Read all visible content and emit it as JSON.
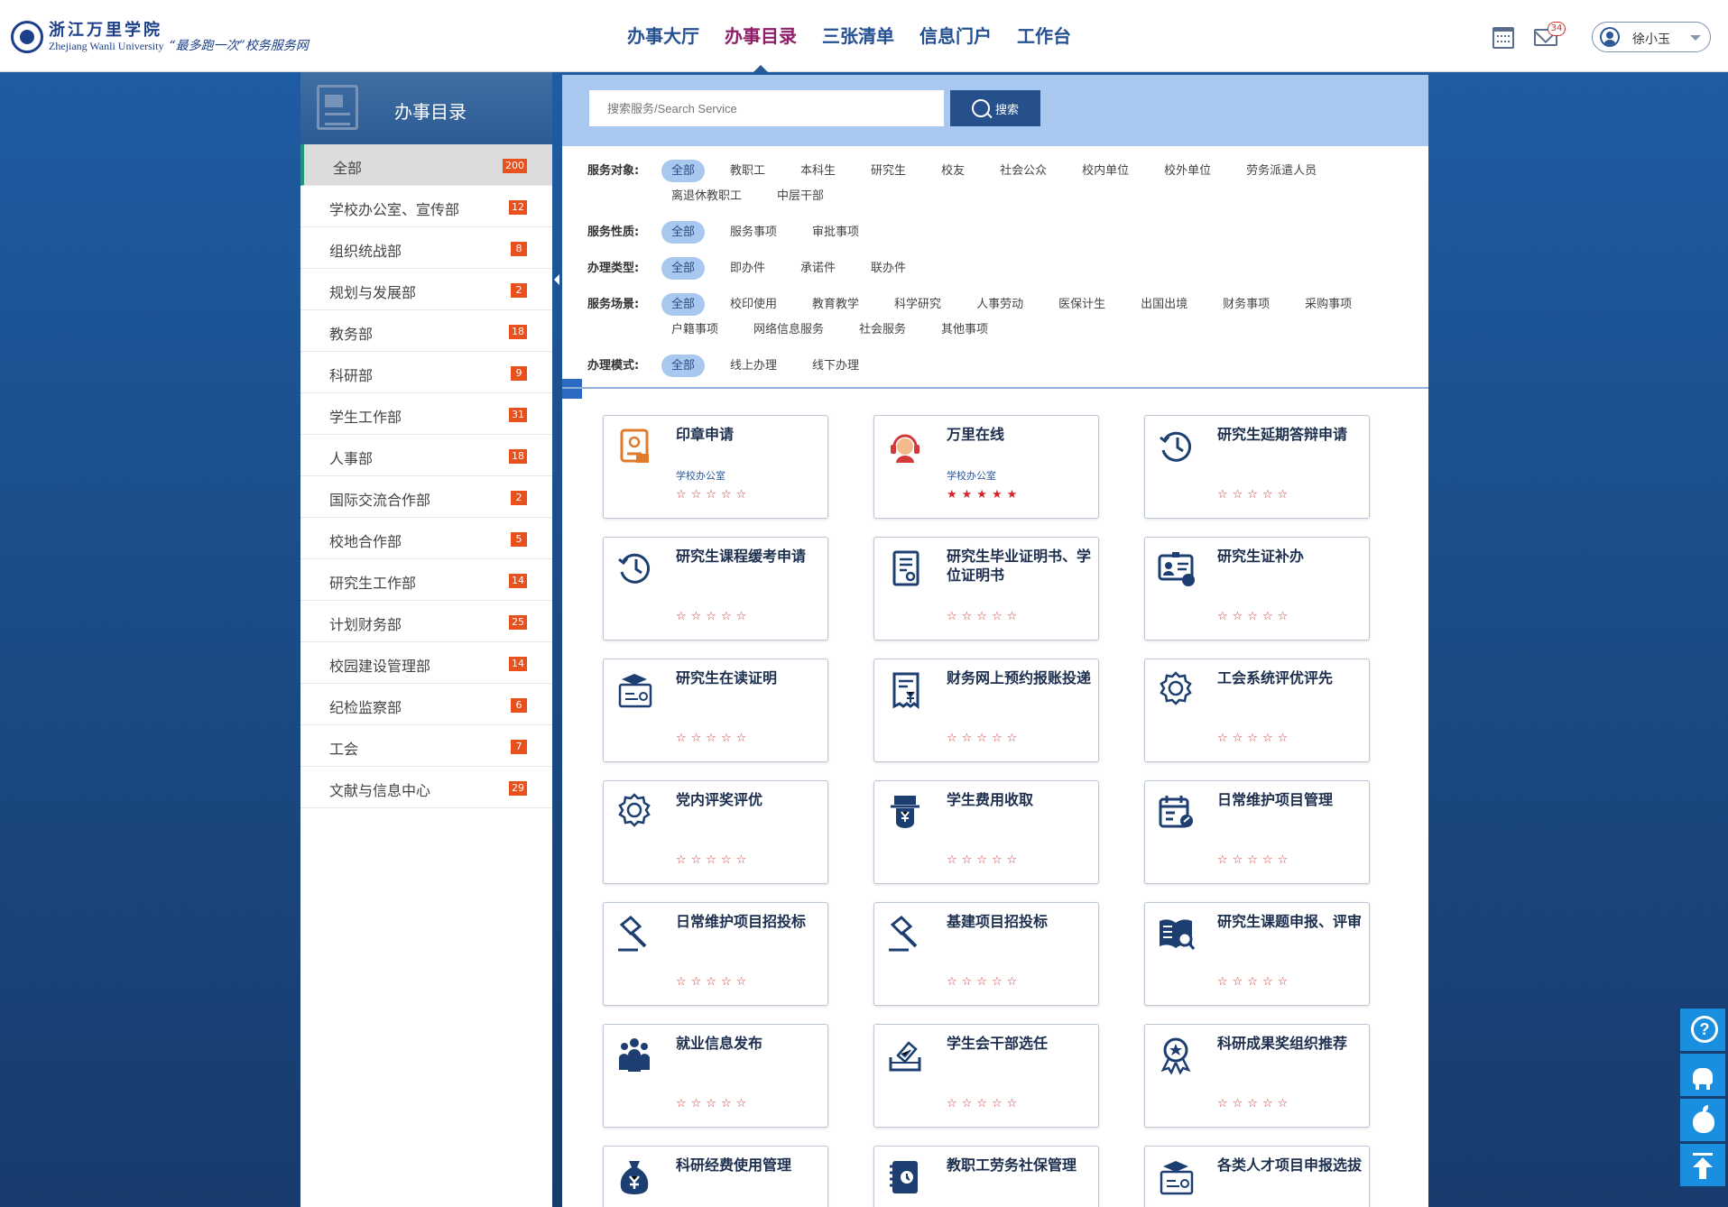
{
  "header": {
    "logo_cn": "浙江万里学院",
    "logo_en": "Zhejiang Wanli University",
    "slogan": "“最多跑一次”校务服务网",
    "nav": [
      {
        "label": "办事大厅",
        "active": false
      },
      {
        "label": "办事目录",
        "active": true
      },
      {
        "label": "三张清单",
        "active": false
      },
      {
        "label": "信息门户",
        "active": false
      },
      {
        "label": "工作台",
        "active": false
      }
    ],
    "mail_count": "34",
    "user_name": "徐小玉"
  },
  "sidebar": {
    "title": "办事目录",
    "items": [
      {
        "label": "全部",
        "count": "200",
        "active": true
      },
      {
        "label": "学校办公室、宣传部",
        "count": "12"
      },
      {
        "label": "组织统战部",
        "count": "8"
      },
      {
        "label": "规划与发展部",
        "count": "2"
      },
      {
        "label": "教务部",
        "count": "18"
      },
      {
        "label": "科研部",
        "count": "9"
      },
      {
        "label": "学生工作部",
        "count": "31"
      },
      {
        "label": "人事部",
        "count": "18"
      },
      {
        "label": "国际交流合作部",
        "count": "2"
      },
      {
        "label": "校地合作部",
        "count": "5"
      },
      {
        "label": "研究生工作部",
        "count": "14"
      },
      {
        "label": "计划财务部",
        "count": "25"
      },
      {
        "label": "校园建设管理部",
        "count": "14"
      },
      {
        "label": "纪检监察部",
        "count": "6"
      },
      {
        "label": "工会",
        "count": "7"
      },
      {
        "label": "文献与信息中心",
        "count": "29"
      }
    ]
  },
  "search": {
    "placeholder": "搜索服务/Search Service",
    "button_label": "搜索"
  },
  "filters": [
    {
      "label": "服务对象:",
      "options": [
        "全部",
        "教职工",
        "本科生",
        "研究生",
        "校友",
        "社会公众",
        "校内单位",
        "校外单位",
        "劳务派遣人员",
        "离退休教职工",
        "中层干部"
      ]
    },
    {
      "label": "服务性质:",
      "options": [
        "全部",
        "服务事项",
        "审批事项"
      ]
    },
    {
      "label": "办理类型:",
      "options": [
        "全部",
        "即办件",
        "承诺件",
        "联办件"
      ]
    },
    {
      "label": "服务场景:",
      "options": [
        "全部",
        "校印使用",
        "教育教学",
        "科学研究",
        "人事劳动",
        "医保计生",
        "出国出境",
        "财务事项",
        "采购事项",
        "户籍事项",
        "网络信息服务",
        "社会服务",
        "其他事项"
      ]
    },
    {
      "label": "办理模式:",
      "options": [
        "全部",
        "线上办理",
        "线下办理"
      ]
    }
  ],
  "services": [
    {
      "title": "印章申请",
      "dept": "学校办公室",
      "icon": "seal-icon",
      "rating": 0
    },
    {
      "title": "万里在线",
      "dept": "学校办公室",
      "icon": "headset-icon",
      "rating": 5
    },
    {
      "title": "研究生延期答辩申请",
      "dept": "",
      "icon": "clock-icon",
      "rating": 0
    },
    {
      "title": "研究生课程缓考申请",
      "dept": "",
      "icon": "clock-icon",
      "rating": 0
    },
    {
      "title": "研究生毕业证明书、学位证明书",
      "dept": "",
      "icon": "certificate-icon",
      "rating": 0
    },
    {
      "title": "研究生证补办",
      "dept": "",
      "icon": "id-card-icon",
      "rating": 0
    },
    {
      "title": "研究生在读证明",
      "dept": "",
      "icon": "graduation-card-icon",
      "rating": 0
    },
    {
      "title": "财务网上预约报账投递",
      "dept": "",
      "icon": "receipt-icon",
      "rating": 0
    },
    {
      "title": "工会系统评优评先",
      "dept": "",
      "icon": "award-icon",
      "rating": 0
    },
    {
      "title": "党内评奖评优",
      "dept": "",
      "icon": "award-icon",
      "rating": 0
    },
    {
      "title": "学生费用收取",
      "dept": "",
      "icon": "payment-icon",
      "rating": 0
    },
    {
      "title": "日常维护项目管理",
      "dept": "",
      "icon": "calendar-edit-icon",
      "rating": 0
    },
    {
      "title": "日常维护项目招投标",
      "dept": "",
      "icon": "gavel-icon",
      "rating": 0
    },
    {
      "title": "基建项目招投标",
      "dept": "",
      "icon": "gavel-icon",
      "rating": 0
    },
    {
      "title": "研究生课题申报、评审",
      "dept": "",
      "icon": "book-search-icon",
      "rating": 0
    },
    {
      "title": "就业信息发布",
      "dept": "",
      "icon": "people-icon",
      "rating": 0
    },
    {
      "title": "学生会干部选任",
      "dept": "",
      "icon": "vote-icon",
      "rating": 0
    },
    {
      "title": "科研成果奖组织推荐",
      "dept": "",
      "icon": "medal-icon",
      "rating": 0
    },
    {
      "title": "科研经费使用管理",
      "dept": "",
      "icon": "money-bag-icon",
      "rating": 0
    },
    {
      "title": "教职工劳务社保管理",
      "dept": "",
      "icon": "notebook-icon",
      "rating": 0
    },
    {
      "title": "各类人才项目申报选拔",
      "dept": "",
      "icon": "graduation-card-icon",
      "rating": 0
    }
  ],
  "colors": {
    "accent": "#8e1d6a",
    "nav": "#255091",
    "badge": "#e8501e",
    "star": "#d23a3a",
    "tool": "#1a8fe0"
  }
}
